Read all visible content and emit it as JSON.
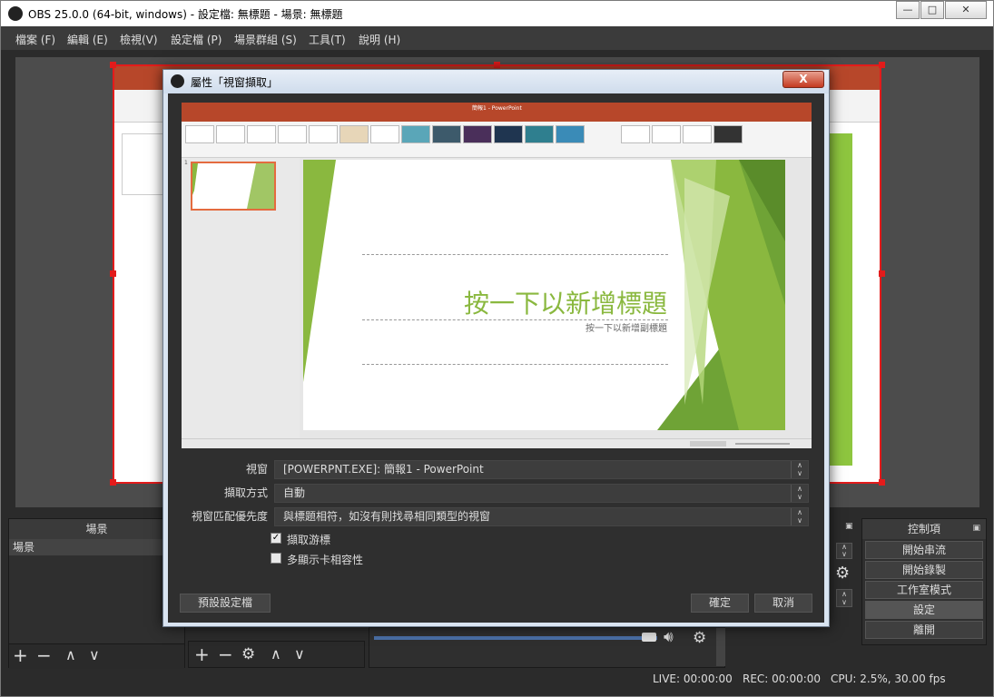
{
  "window": {
    "title": "OBS 25.0.0 (64-bit, windows) - 設定檔: 無標題 - 場景: 無標題",
    "controls": {
      "minimize": "—",
      "maximize": "□",
      "close": "✕"
    }
  },
  "menu": [
    "檔案 (F)",
    "編輯 (E)",
    "檢視(V)",
    "設定檔 (P)",
    "場景群組 (S)",
    "工具(T)",
    "說明 (H)"
  ],
  "docks": {
    "scenes": {
      "title": "場景",
      "items": [
        "場景"
      ]
    },
    "controls": {
      "title": "控制項",
      "buttons": [
        "開始串流",
        "開始錄製",
        "工作室模式",
        "設定",
        "離開"
      ]
    }
  },
  "status": {
    "live": "LIVE: 00:00:00",
    "rec": "REC: 00:00:00",
    "cpu": "CPU: 2.5%, 30.00 fps"
  },
  "dialog": {
    "title": "屬性「視窗擷取」",
    "close_label": "X",
    "preview": {
      "slide_title": "按一下以新增標題",
      "slide_subtitle": "按一下以新增副標題",
      "app_title": "簡報1 - PowerPoint",
      "slide_number": "1"
    },
    "fields": [
      {
        "label": "視窗",
        "value": "[POWERPNT.EXE]: 簡報1 - PowerPoint"
      },
      {
        "label": "擷取方式",
        "value": "自動"
      },
      {
        "label": "視窗匹配優先度",
        "value": "與標題相符，如沒有則找尋相同類型的視窗"
      }
    ],
    "checkboxes": [
      {
        "label": "擷取游標",
        "checked": true
      },
      {
        "label": "多顯示卡相容性",
        "checked": false
      }
    ],
    "buttons": {
      "defaults": "預設設定檔",
      "ok": "確定",
      "cancel": "取消"
    }
  },
  "colors": {
    "accent_red": "#e31b1b",
    "ppt_orange": "#b7472a",
    "slide_green": "#8ab83f"
  }
}
